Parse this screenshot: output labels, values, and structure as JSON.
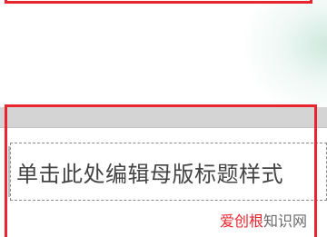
{
  "slide": {
    "title_placeholder": "单击此处编辑母版标题样式"
  },
  "watermark": {
    "part1": "爱创根",
    "part2": "知识网"
  },
  "colors": {
    "highlight": "#e8242c",
    "band": "#d4d4d4"
  }
}
